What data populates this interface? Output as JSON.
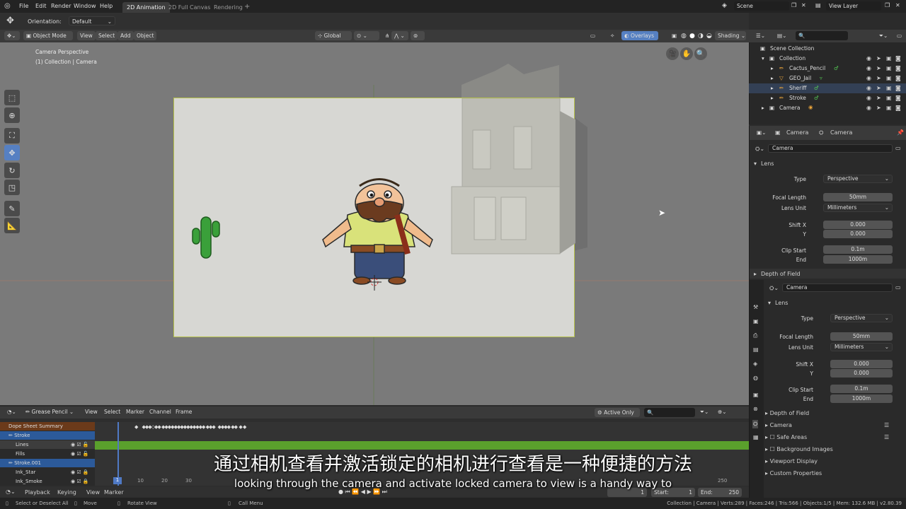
{
  "menubar": {
    "items": [
      "File",
      "Edit",
      "Render",
      "Window",
      "Help"
    ],
    "tabs": [
      "2D Animation",
      "2D Full Canvas",
      "Rendering"
    ],
    "active_tab": "2D Animation",
    "add_tab": "+",
    "scene": "Scene",
    "view_layer": "View Layer"
  },
  "topbar": {
    "orientation_label": "Orientation:",
    "orientation_value": "Default"
  },
  "viewport_header": {
    "mode": "Object Mode",
    "menus": [
      "View",
      "Select",
      "Add",
      "Object"
    ],
    "transform": "Global",
    "overlays": "Overlays",
    "shading": "Shading"
  },
  "viewport": {
    "info_line1": "Camera Perspective",
    "info_line2": "(1) Collection | Camera"
  },
  "outliner": {
    "root": "Scene Collection",
    "collection": "Collection",
    "items": [
      "Cactus_Pencil",
      "GEO_Jail",
      "Sheriff",
      "Stroke",
      "Camera"
    ]
  },
  "props_top": {
    "tab1": "Camera",
    "tab2": "Camera",
    "data_name": "Camera",
    "panel_lens": "Lens",
    "type_label": "Type",
    "type_value": "Perspective",
    "focal_label": "Focal Length",
    "focal_value": "50mm",
    "unit_label": "Lens Unit",
    "unit_value": "Millimeters",
    "shiftx_label": "Shift X",
    "shiftx_value": "0.000",
    "y_label": "Y",
    "y_value": "0.000",
    "clip_label": "Clip Start",
    "clip_value": "0.1m",
    "end_label": "End",
    "end_value": "1000m",
    "dof": "Depth of Field"
  },
  "props_bottom": {
    "data_name": "Camera",
    "panel_lens": "Lens",
    "type_label": "Type",
    "type_value": "Perspective",
    "focal_label": "Focal Length",
    "focal_value": "50mm",
    "unit_label": "Lens Unit",
    "unit_value": "Millimeters",
    "shiftx_label": "Shift X",
    "shiftx_value": "0.000",
    "y_label": "Y",
    "y_value": "0.000",
    "clip_label": "Clip Start",
    "clip_value": "0.1m",
    "end_label": "End",
    "end_value": "1000m",
    "panels": [
      "Depth of Field",
      "Camera",
      "Safe Areas",
      "Background Images",
      "Viewport Display",
      "Custom Properties"
    ]
  },
  "dopesheet": {
    "mode": "Grease Pencil",
    "menus": [
      "View",
      "Select",
      "Marker",
      "Channel",
      "Frame"
    ],
    "active_only": "Active Only",
    "channels": [
      "Dope Sheet Summary",
      "Stroke",
      "Lines",
      "Fills",
      "Stroke.001",
      "Ink_Star",
      "Ink_Smoke"
    ],
    "frame_numbers": [
      "1",
      "10",
      "20",
      "30",
      "250"
    ]
  },
  "timeline": {
    "menus": [
      "Playback",
      "Keying",
      "View",
      "Marker"
    ],
    "current_frame": "1",
    "start_label": "Start:",
    "start_value": "1",
    "end_label": "End:",
    "end_value": "250"
  },
  "statusbar": {
    "hint1": "Select or Deselect All",
    "hint2": "Move",
    "hint3": "Rotate View",
    "hint4": "Call Menu",
    "stats": "Collection | Camera | Verts:289 | Faces:246 | Tris:566 | Objects:1/5 | Mem: 132.6 MB | v2.80.39"
  },
  "subtitles": {
    "cn": "通过相机查看并激活锁定的相机进行查看是一种便捷的方法",
    "en": "looking through the camera and activate locked camera to view is a handy way to"
  },
  "colors": {
    "accent": "#5680c2",
    "camera_frame": "#b6c24a",
    "keyframe_bar": "#5aa02c"
  }
}
